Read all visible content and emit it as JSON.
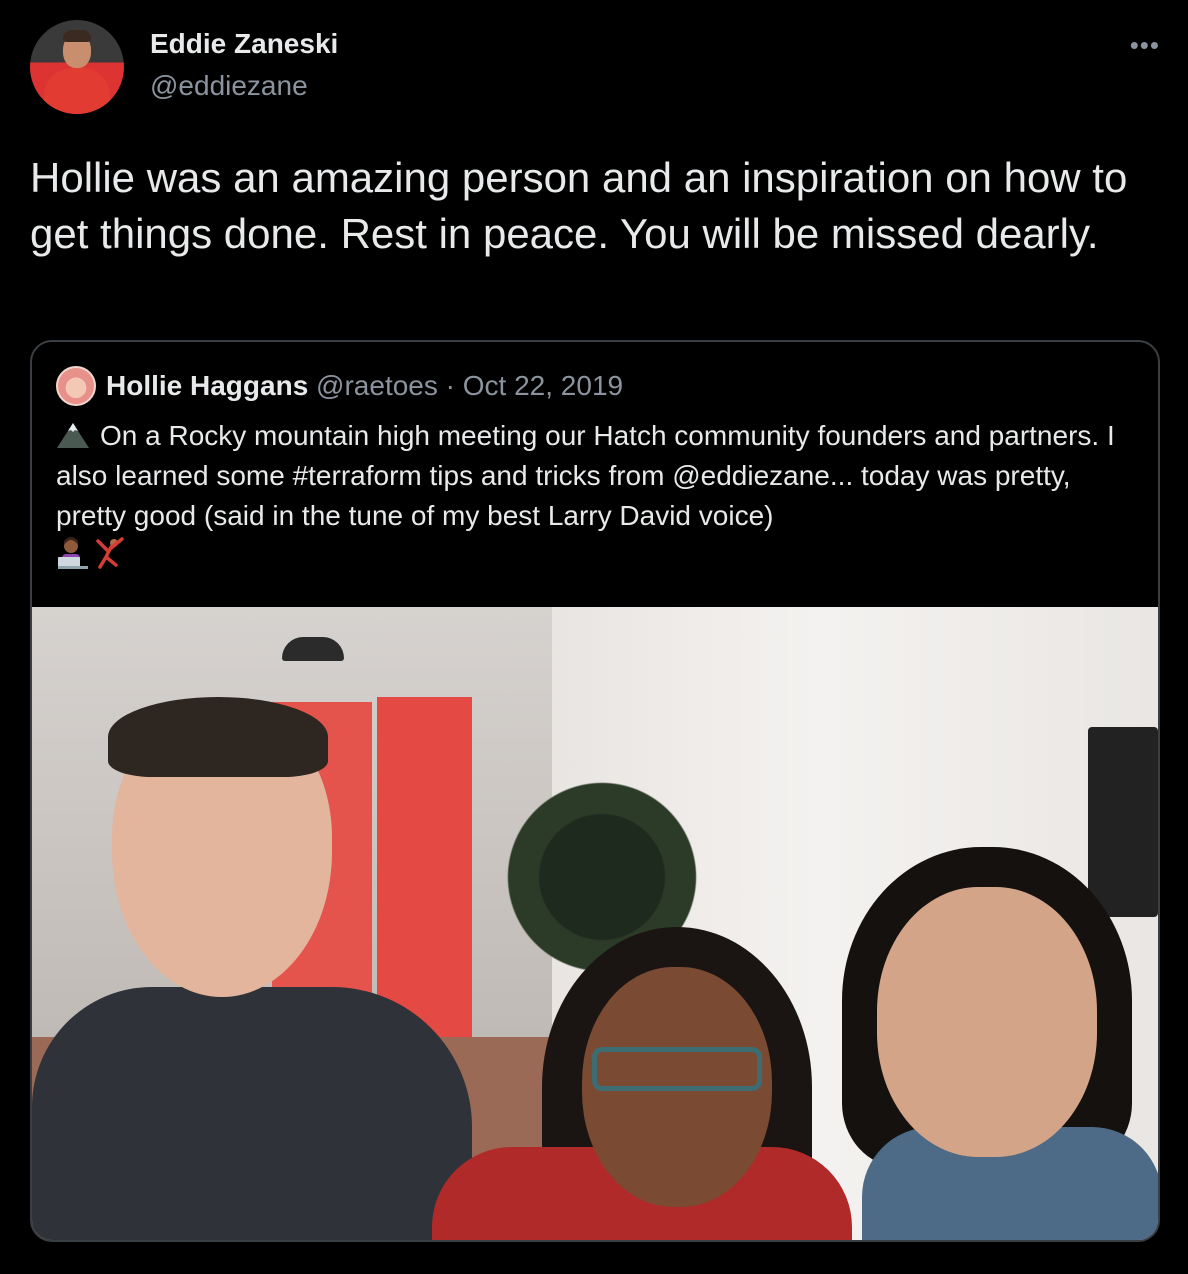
{
  "author": {
    "name": "Eddie Zaneski",
    "handle": "@eddiezane",
    "more_label": "•••"
  },
  "tweet": {
    "text": "Hollie was an amazing person and an inspiration on how to get things done. Rest in peace. You will be missed dearly."
  },
  "quoted": {
    "name": "Hollie Haggans",
    "handle": "@raetoes",
    "separator": " · ",
    "date": "Oct 22, 2019",
    "text": "On a Rocky mountain high meeting our Hatch community founders and partners. I also learned some #terraform tips and tricks from @eddiezane... today was pretty, pretty good (said in the tune of my best Larry David voice)"
  },
  "icons": {
    "more": "more-dots-icon",
    "mountain": "mountain-emoji",
    "technologist": "technologist-emoji",
    "cartwheel": "cartwheel-emoji"
  },
  "colors": {
    "background": "#000000",
    "primary_text": "#e7e9ea",
    "secondary_text": "#8b949e",
    "border": "#3a3f44"
  }
}
